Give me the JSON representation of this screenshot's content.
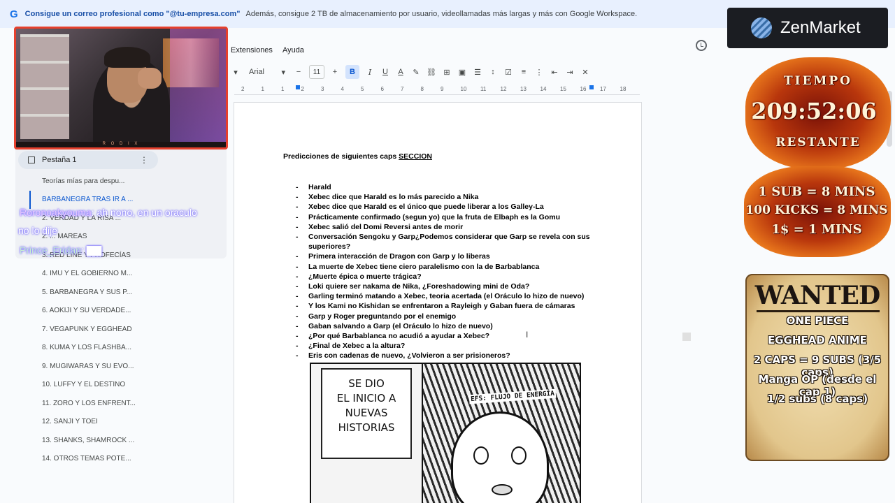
{
  "banner": {
    "logo": "G",
    "headline": "Consigue un correo profesional como \"@tu-empresa.com\"",
    "details": "Además, consigue 2 TB de almacenamiento por usuario, videollamadas más largas y más con Google Workspace."
  },
  "menu": {
    "items": [
      "Extensiones",
      "Ayuda"
    ]
  },
  "toolbar": {
    "font": "Arial",
    "font_size": "11",
    "minus": "−",
    "plus": "+",
    "bold": "B",
    "italic": "I",
    "underline": "U",
    "color_a": "A"
  },
  "ruler": {
    "ticks": [
      "2",
      "1",
      "1",
      "2",
      "3",
      "4",
      "5",
      "6",
      "7",
      "8",
      "9",
      "10",
      "11",
      "12",
      "13",
      "14",
      "15",
      "16",
      "17",
      "18"
    ]
  },
  "sidebar": {
    "tab_label": "Pestaña 1",
    "items": [
      "Teorías mías para despu...",
      "BARBANEGRA TRAS IR A ...",
      "2. VERDAD Y LA RISA ...",
      "2. ... MAREAS",
      "3. RED LINE Y PROFECÍAS",
      "4. IMU Y EL GOBIERNO M...",
      "5. BARBANEGRA Y SUS P...",
      "6. AOKIJI Y SU VERDADE...",
      "7. VEGAPUNK Y EGGHEAD",
      "8. KUMA Y LOS FLASHBA...",
      "9. MUGIWARAS Y SU EVO...",
      "10. LUFFY Y EL DESTINO",
      "11. ZORO Y LOS ENFRENT...",
      "12. SANJI Y TOEI",
      "13. SHANKS, SHAMROCK ...",
      "14. OTROS TEMAS POTE..."
    ]
  },
  "chat": {
    "user1": "Roronoakyouma",
    "msg1_part1": ": ah nono, en un oraculo",
    "msg1_part2": "no lo dije",
    "user2": "Prince_Eridan",
    "msg2": ": ▇▇"
  },
  "webcam": {
    "name_tag": "R O D I X"
  },
  "document": {
    "title_main": "Predicciones de siguientes caps ",
    "title_underlined": "SECCION",
    "items": [
      "Harald",
      "Xebec dice que Harald es lo más parecido a Nika",
      "Xebec dice que Harald es el único que puede liberar a los Galley-La",
      "Prácticamente confirmado (segun yo) que la fruta de Elbaph es la Gomu",
      "Xebec salió del Domi Reversi antes de morir",
      "Conversación Sengoku y Garp¿Podemos considerar que Garp se revela con sus superiores?",
      "Primera interacción de Dragon con Garp y lo liberas",
      "La muerte de Xebec tiene ciero paralelismo con la de Barbablanca",
      "¿Muerte épica o muerte trágica?",
      "Loki quiere ser nakama de Nika, ¿Foreshadowing mini de Oda?",
      "Garling terminó matando a Xebec, teoria acertada (el Oráculo lo hizo de nuevo)",
      "Y los Kami no Kishidan se enfrentaron a Rayleigh y Gaban fuera de cámaras",
      "Garp y Roger preguntando por el enemigo",
      "Gaban salvando a Garp (el Oráculo lo hizo de nuevo)",
      "¿Por qué Barbablanca no acudió a ayudar a Xebec?",
      "¿Final de Xebec a la altura?",
      "Eris con cadenas de nuevo, ¿Volvieron a ser prisioneros?"
    ],
    "manga_box_lines": [
      "SE DIO",
      "EL INICIO A",
      "NUEVAS",
      "HISTORIAS"
    ],
    "manga_sfx": "EFS: FLUJO DE ENERGÍA"
  },
  "overlays": {
    "zen_brand": "ZenMarket",
    "timer_label": "TIEMPO",
    "timer_value": "209:52:06",
    "timer_sub": "RESTANTE",
    "rule1": "1 SUB = 8 MINS",
    "rule2": "100 KICKS = 8 MINS",
    "rule3": "1$ = 1 MINS",
    "wanted_title": "WANTED",
    "wanted_lines": [
      "ONE PIECE",
      "EGGHEAD ANIME",
      "2 CAPS = 9 SUBS (3/5 caps)",
      "Manga OP (desde el cap 1)",
      "1/2 subs (8 caps)"
    ]
  },
  "colors": {
    "accent": "#0b57d0",
    "banner_bg": "#e8f0fe",
    "webcam_border": "#e6402d"
  }
}
